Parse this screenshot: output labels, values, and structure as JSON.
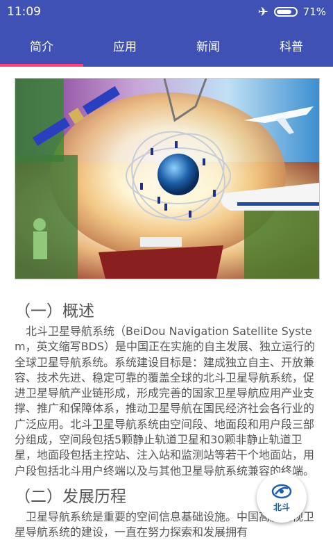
{
  "status_bar": {
    "time": "11:09",
    "battery": "71%"
  },
  "tabs": [
    {
      "label": "简介",
      "active": true
    },
    {
      "label": "应用",
      "active": false
    },
    {
      "label": "新闻",
      "active": false
    },
    {
      "label": "科普",
      "active": false
    }
  ],
  "sections": [
    {
      "heading": "（一）概述",
      "body": "北斗卫星导航系统（BeiDou Navigation Satellite System，英文缩写BDS）是中国正在实施的自主发展、独立运行的全球卫星导航系统。系统建设目标是：建成独立自主、开放兼容、技术先进、稳定可靠的覆盖全球的北斗卫星导航系统，促进卫星导航产业链形成，形成完善的国家卫星导航应用产业支撑、推广和保障体系，推动卫星导航在国民经济社会各行业的广泛应用。北斗卫星导航系统由空间段、地面段和用户段三部分组成，空间段包括5颗静止轨道卫星和30颗非静止轨道卫星，地面段包括主控站、注入站和监测站等若干个地面站，用户段包括北斗用户终端以及与其他卫星导航系统兼容的终端。"
    },
    {
      "heading": "（二）发展历程",
      "body": "卫星导航系统是重要的空间信息基础设施。中国高度重视卫星导航系统的建设，一直在努力探索和发展拥有"
    }
  ],
  "fab": {
    "label": "北斗",
    "icon": "beidou-logo-icon"
  },
  "colors": {
    "primary": "#3f51b5",
    "indicator": "#ff4081"
  }
}
